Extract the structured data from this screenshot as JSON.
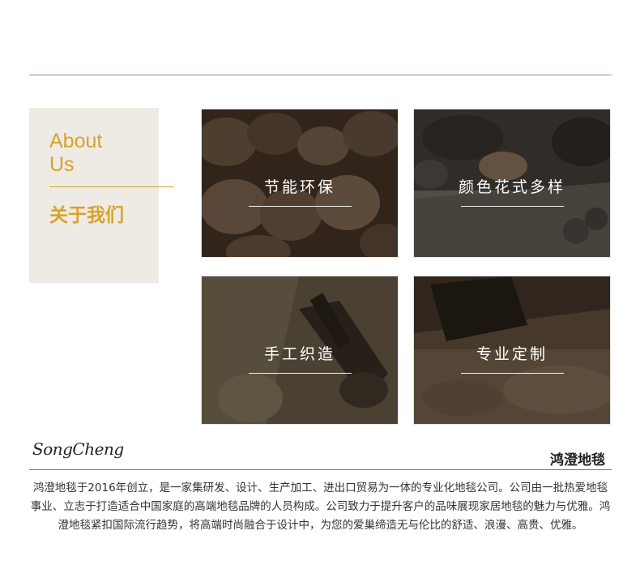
{
  "about": {
    "en_line1": "About",
    "en_line2": "Us",
    "cn": "关于我们"
  },
  "features": [
    {
      "label": "节能环保",
      "icon": "yarn-spools-photo"
    },
    {
      "label": "颜色花式多样",
      "icon": "rug-tufting-photo"
    },
    {
      "label": "手工织造",
      "icon": "tufting-gun-photo"
    },
    {
      "label": "专业定制",
      "icon": "carpet-trimming-photo"
    }
  ],
  "footer": {
    "logo": "SongCheng",
    "brand": "鸿澄地毯",
    "description": "鸿澄地毯于2016年创立，是一家集研发、设计、生产加工、进出口贸易为一体的专业化地毯公司。公司由一批热爱地毯事业、立志于打造适合中国家庭的高端地毯品牌的人员构成。公司致力于提升客户的品味展现家居地毯的魅力与优雅。鸿澄地毯紧扣国际流行趋势，将高端时尚融合于设计中，为您的爱巢缔造无与伦比的舒适、浪漫、高贵、优雅。"
  },
  "colors": {
    "accent": "#d9a22b",
    "card_bg": "#eeebe4"
  }
}
